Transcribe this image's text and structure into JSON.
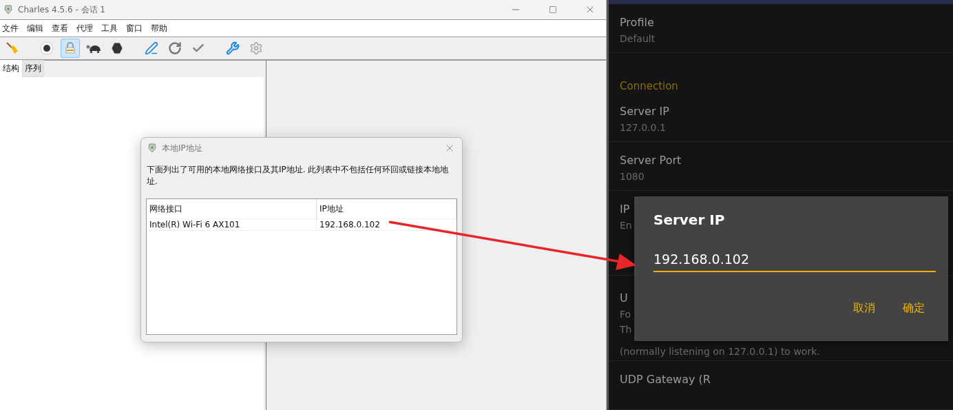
{
  "charles": {
    "title": "Charles 4.5.6 - 会话 1",
    "menu": [
      "文件",
      "编辑",
      "查看",
      "代理",
      "工具",
      "窗口",
      "帮助"
    ],
    "toolbar": [
      {
        "kind": "broom",
        "on": false
      },
      {
        "kind": "record",
        "on": false
      },
      {
        "kind": "lock",
        "on": true
      },
      {
        "kind": "turtle",
        "on": false
      },
      {
        "kind": "stop",
        "on": false
      },
      {
        "kind": "pen",
        "on": false
      },
      {
        "kind": "refresh",
        "on": false
      },
      {
        "kind": "check",
        "on": false
      },
      {
        "kind": "tools",
        "on": false
      },
      {
        "kind": "gear",
        "on": false
      }
    ],
    "tabs": [
      {
        "label": "结构",
        "selected": true
      },
      {
        "label": "序列",
        "selected": false
      }
    ]
  },
  "ip_dialog": {
    "title": "本地IP地址",
    "message": "下面列出了可用的本地网络接口及其IP地址. 此列表中不包括任何环回或链接本地地址.",
    "columns": [
      "网络接口",
      "IP地址"
    ],
    "rows": [
      [
        "Intel(R) Wi-Fi 6 AX101",
        "192.168.0.102"
      ]
    ]
  },
  "android": {
    "items": [
      {
        "kind": "setting",
        "title": "Profile",
        "value": "Default"
      },
      {
        "kind": "header",
        "title": "Connection"
      },
      {
        "kind": "setting",
        "title": "Server IP",
        "value": "127.0.0.1"
      },
      {
        "kind": "setting",
        "title": "Server Port",
        "value": "1080"
      },
      {
        "kind": "setting",
        "title": "IP",
        "value": "En"
      },
      {
        "kind": "setting",
        "title": "U",
        "value": "Fo",
        "extra": [
          "Th",
          "(normally listening on 127.0.0.1) to work."
        ]
      },
      {
        "kind": "setting",
        "title": "UDP Gateway (R"
      }
    ],
    "dialog": {
      "title": "Server IP",
      "value": "192.168.0.102",
      "buttons": [
        "取消",
        "确定"
      ]
    }
  }
}
